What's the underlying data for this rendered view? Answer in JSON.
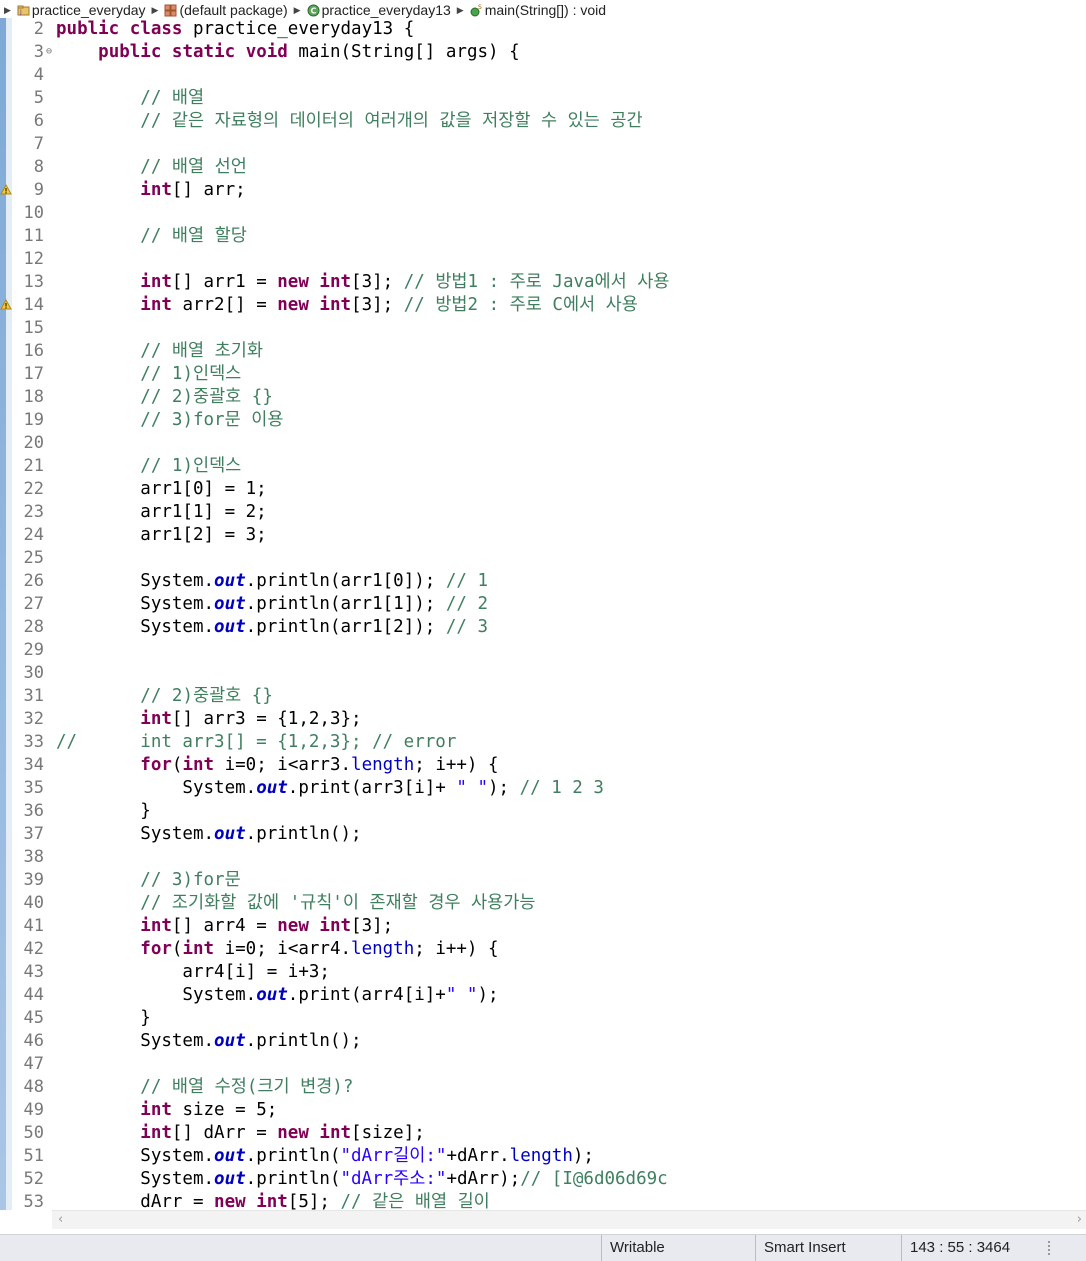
{
  "breadcrumb": {
    "project": "practice_everyday",
    "package": "(default package)",
    "class": "practice_everyday13",
    "method": "main(String[]) : void"
  },
  "editor": {
    "lines": [
      {
        "n": "2",
        "html": "<span class=\"kw\">public</span> <span class=\"kw\">class</span> practice_everyday13 {"
      },
      {
        "n": "3",
        "fold": "⊖",
        "html": "    <span class=\"kw\">public</span> <span class=\"kw\">static</span> <span class=\"kw\">void</span> main(String[] args) {"
      },
      {
        "n": "4",
        "html": ""
      },
      {
        "n": "5",
        "html": "        <span class=\"cm\">// 배열</span>"
      },
      {
        "n": "6",
        "html": "        <span class=\"cm\">// 같은 자료형의 데이터의 여러개의 값을 저장할 수 있는 공간</span>"
      },
      {
        "n": "7",
        "html": ""
      },
      {
        "n": "8",
        "html": "        <span class=\"cm\">// 배열 선언</span>"
      },
      {
        "n": "9",
        "marker": true,
        "html": "        <span class=\"kw\">int</span>[] arr;"
      },
      {
        "n": "10",
        "html": ""
      },
      {
        "n": "11",
        "html": "        <span class=\"cm\">// 배열 할당</span>"
      },
      {
        "n": "12",
        "html": ""
      },
      {
        "n": "13",
        "html": "        <span class=\"kw\">int</span>[] arr1 = <span class=\"kw\">new</span> <span class=\"kw\">int</span>[3]; <span class=\"cm\">// 방법1 : 주로 Java에서 사용</span>"
      },
      {
        "n": "14",
        "marker": true,
        "html": "        <span class=\"kw\">int</span> arr2[] = <span class=\"kw\">new</span> <span class=\"kw\">int</span>[3]; <span class=\"cm\">// 방법2 : 주로 C에서 사용</span>"
      },
      {
        "n": "15",
        "html": ""
      },
      {
        "n": "16",
        "html": "        <span class=\"cm\">// 배열 초기화</span>"
      },
      {
        "n": "17",
        "html": "        <span class=\"cm\">// 1)인덱스</span>"
      },
      {
        "n": "18",
        "html": "        <span class=\"cm\">// 2)중괄호 {}</span>"
      },
      {
        "n": "19",
        "html": "        <span class=\"cm\">// 3)for문 이용</span>"
      },
      {
        "n": "20",
        "html": ""
      },
      {
        "n": "21",
        "html": "        <span class=\"cm\">// 1)인덱스</span>"
      },
      {
        "n": "22",
        "html": "        arr1[0] = 1;"
      },
      {
        "n": "23",
        "html": "        arr1[1] = 2;"
      },
      {
        "n": "24",
        "html": "        arr1[2] = 3;"
      },
      {
        "n": "25",
        "html": ""
      },
      {
        "n": "26",
        "html": "        System.<span class=\"fd\">out</span>.println(arr1[0]); <span class=\"cm\">// 1</span>"
      },
      {
        "n": "27",
        "html": "        System.<span class=\"fd\">out</span>.println(arr1[1]); <span class=\"cm\">// 2</span>"
      },
      {
        "n": "28",
        "html": "        System.<span class=\"fd\">out</span>.println(arr1[2]); <span class=\"cm\">// 3</span>"
      },
      {
        "n": "29",
        "html": ""
      },
      {
        "n": "30",
        "html": ""
      },
      {
        "n": "31",
        "html": "        <span class=\"cm\">// 2)중괄호 {}</span>"
      },
      {
        "n": "32",
        "html": "        <span class=\"kw\">int</span>[] arr3 = {1,2,3};"
      },
      {
        "n": "33",
        "html": "<span class=\"cm\">//      int arr3[] = {1,2,3}; // error</span>"
      },
      {
        "n": "34",
        "html": "        <span class=\"kw\">for</span>(<span class=\"kw\">int</span> i=0; i&lt;arr3.<span class=\"fl\">length</span>; i++) {"
      },
      {
        "n": "35",
        "html": "            System.<span class=\"fd\">out</span>.print(arr3[i]+ <span class=\"st\">\" \"</span>); <span class=\"cm\">// 1 2 3</span>"
      },
      {
        "n": "36",
        "html": "        }"
      },
      {
        "n": "37",
        "html": "        System.<span class=\"fd\">out</span>.println();"
      },
      {
        "n": "38",
        "html": ""
      },
      {
        "n": "39",
        "html": "        <span class=\"cm\">// 3)for문</span>"
      },
      {
        "n": "40",
        "html": "        <span class=\"cm\">// 조기화할 값에 '규칙'이 존재할 경우 사용가능</span>"
      },
      {
        "n": "41",
        "html": "        <span class=\"kw\">int</span>[] arr4 = <span class=\"kw\">new</span> <span class=\"kw\">int</span>[3];"
      },
      {
        "n": "42",
        "html": "        <span class=\"kw\">for</span>(<span class=\"kw\">int</span> i=0; i&lt;arr4.<span class=\"fl\">length</span>; i++) {"
      },
      {
        "n": "43",
        "html": "            arr4[i] = i+3;"
      },
      {
        "n": "44",
        "html": "            System.<span class=\"fd\">out</span>.print(arr4[i]+<span class=\"st\">\" \"</span>);"
      },
      {
        "n": "45",
        "html": "        }"
      },
      {
        "n": "46",
        "html": "        System.<span class=\"fd\">out</span>.println();"
      },
      {
        "n": "47",
        "html": ""
      },
      {
        "n": "48",
        "html": "        <span class=\"cm\">// 배열 수정(크기 변경)?</span>"
      },
      {
        "n": "49",
        "html": "        <span class=\"kw\">int</span> size = 5;"
      },
      {
        "n": "50",
        "html": "        <span class=\"kw\">int</span>[] dArr = <span class=\"kw\">new</span> <span class=\"kw\">int</span>[size];"
      },
      {
        "n": "51",
        "html": "        System.<span class=\"fd\">out</span>.println(<span class=\"st\">\"dArr길이:\"</span>+dArr.<span class=\"fl\">length</span>);"
      },
      {
        "n": "52",
        "html": "        System.<span class=\"fd\">out</span>.println(<span class=\"st\">\"dArr주소:\"</span>+dArr);<span class=\"cm\">// [I@6d06d69c</span>"
      },
      {
        "n": "53",
        "html": "        dArr = <span class=\"kw\">new</span> <span class=\"kw\">int</span>[5]; <span class=\"cm\">// 같은 배열 길이</span>"
      }
    ]
  },
  "statusbar": {
    "mode": "Writable",
    "insert": "Smart Insert",
    "position": "143 : 55 : 3464"
  },
  "colors": {
    "keyword": "#7f0055",
    "comment": "#3f7f5f",
    "string": "#2a00ff",
    "field": "#0000c0"
  }
}
